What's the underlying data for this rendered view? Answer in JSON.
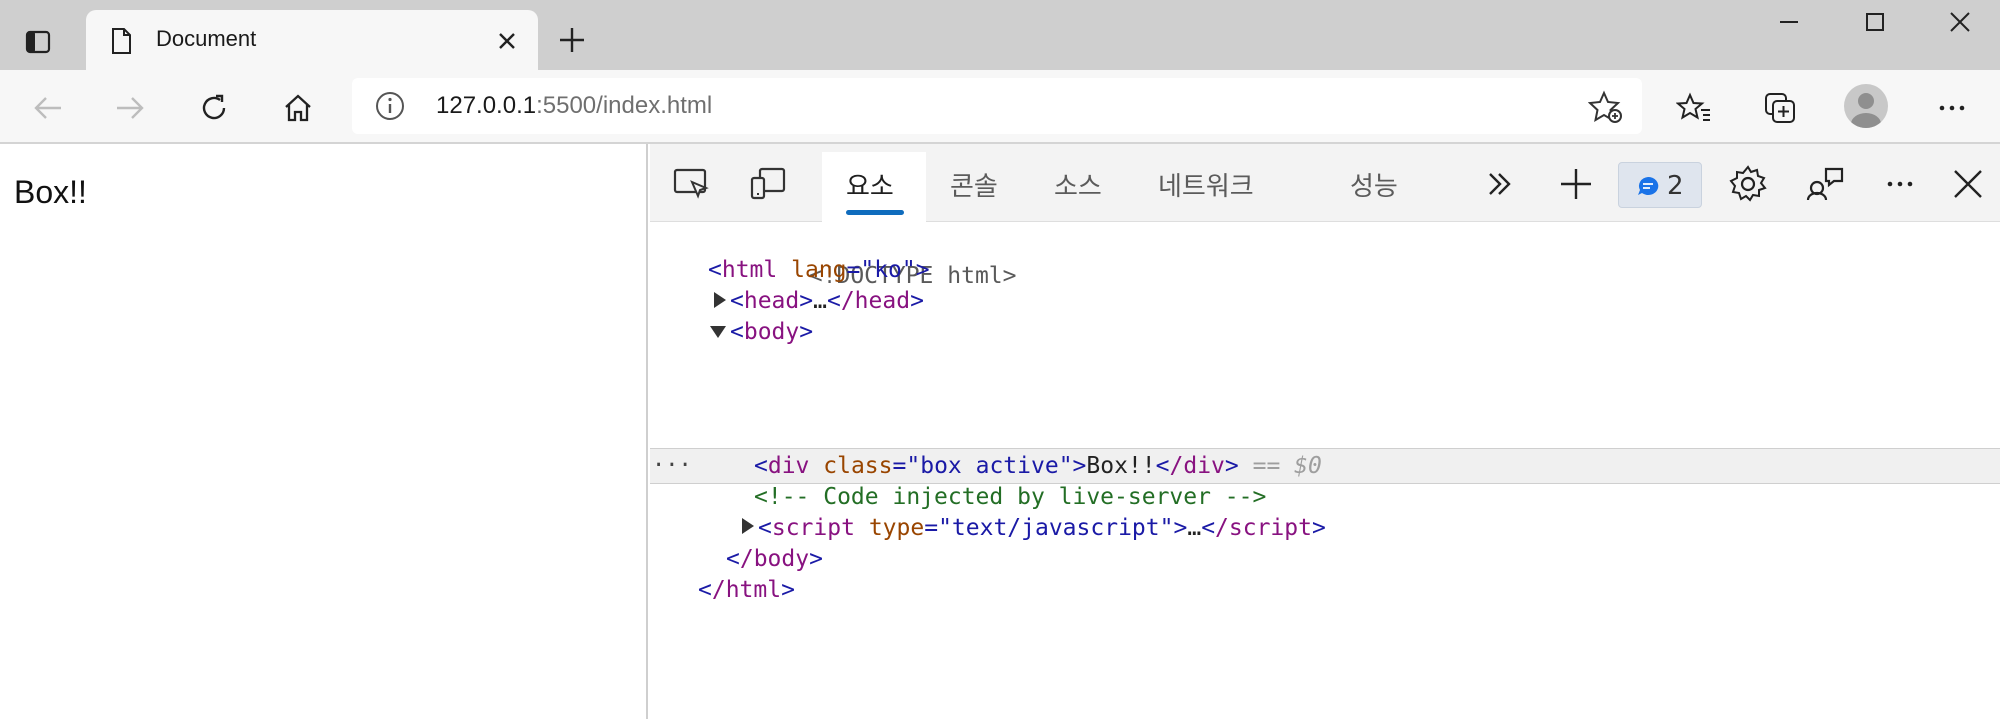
{
  "browser": {
    "tab_title": "Document",
    "address": {
      "host": "127.0.0.1",
      "path": ":5500/index.html"
    }
  },
  "page": {
    "content_text": "Box!!"
  },
  "devtools": {
    "tabs": [
      {
        "label": "요소",
        "active": true
      },
      {
        "label": "콘솔",
        "active": false
      },
      {
        "label": "소스",
        "active": false
      },
      {
        "label": "네트워크",
        "active": false
      },
      {
        "label": "성능",
        "active": false
      }
    ],
    "issues_count": "2",
    "dom_lines": {
      "doctype": "<!DOCTYPE html>",
      "html_open_tag": "html",
      "html_lang_attr": "lang",
      "html_lang_val": "\"ko\"",
      "head_open": "head",
      "head_ellipsis": "…",
      "head_close": "/head",
      "body_open": "body",
      "div_tag": "div",
      "div_class_attr": "class",
      "div_class_val": "\"box active\"",
      "div_text": "Box!!",
      "div_close": "/div",
      "selected_marker": "== $0",
      "comment": "<!-- Code injected by live-server -->",
      "script_tag": "script",
      "script_type_attr": "type",
      "script_type_val": "\"text/javascript\"",
      "script_ellipsis": "…",
      "script_close": "/script",
      "body_close": "/body",
      "html_close": "/html"
    },
    "row_dots": "···"
  },
  "colors": {
    "accent": "#0f6cbd",
    "titlebar": "#cfcfcf",
    "toolbar": "#f7f7f7"
  }
}
